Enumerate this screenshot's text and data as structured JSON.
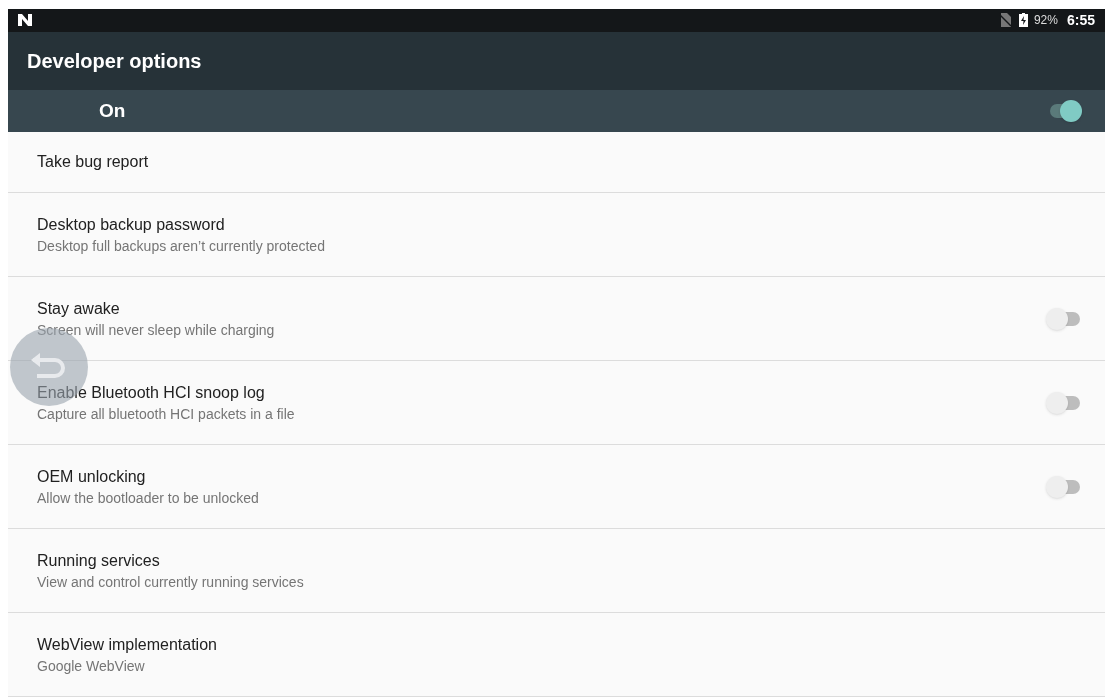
{
  "status_bar": {
    "battery": "92%",
    "time": "6:55"
  },
  "app_bar": {
    "title": "Developer options"
  },
  "master_switch": {
    "label": "On",
    "on": true
  },
  "items": [
    {
      "kind": "plain",
      "title": "Take bug report"
    },
    {
      "kind": "plain",
      "title": "Desktop backup password",
      "summary": "Desktop full backups aren’t currently protected"
    },
    {
      "kind": "switch",
      "title": "Stay awake",
      "summary": "Screen will never sleep while charging",
      "on": false
    },
    {
      "kind": "switch",
      "title": "Enable Bluetooth HCI snoop log",
      "summary": "Capture all bluetooth HCI packets in a file",
      "on": false
    },
    {
      "kind": "switch",
      "title": "OEM unlocking",
      "summary": "Allow the bootloader to be unlocked",
      "on": false
    },
    {
      "kind": "plain",
      "title": "Running services",
      "summary": "View and control currently running services"
    },
    {
      "kind": "plain",
      "title": "WebView implementation",
      "summary": "Google WebView"
    }
  ]
}
